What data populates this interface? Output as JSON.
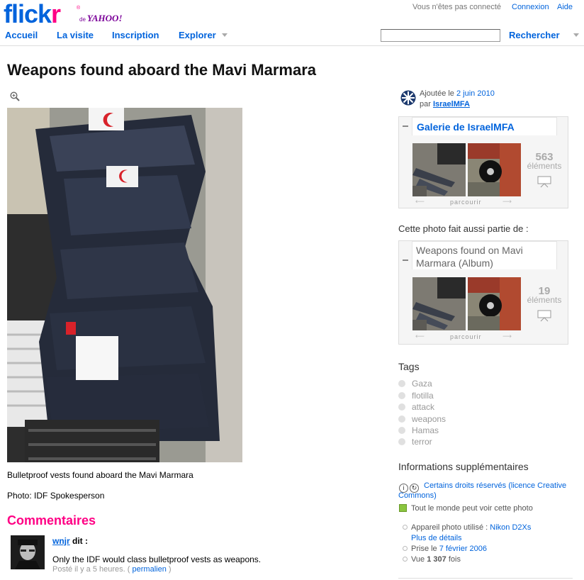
{
  "brand": {
    "logo_part1": "flick",
    "logo_part2": "r",
    "logo_reg": "®",
    "logo_de": "de",
    "logo_yahoo": "YAHOO!"
  },
  "topbar": {
    "status": "Vous n'êtes pas connecté",
    "login": "Connexion",
    "help": "Aide"
  },
  "nav": {
    "home": "Accueil",
    "tour": "La visite",
    "signup": "Inscription",
    "explore": "Explorer"
  },
  "search": {
    "value": "",
    "button": "Rechercher"
  },
  "photo": {
    "title": "Weapons found aboard the Mavi Marmara",
    "caption": "Bulletproof vests found aboard the Mavi Marmara",
    "credit": "Photo: IDF Spokesperson"
  },
  "comments": {
    "heading": "Commentaires",
    "items": [
      {
        "author": "wnjr",
        "says": "dit :",
        "text": "Only the IDF would class bulletproof vests as weapons.",
        "posted": "Posté il y a 5 heures.",
        "permalink": "permalien"
      }
    ]
  },
  "owner": {
    "added_prefix": "Ajoutée le",
    "added_date": "2 juin 2010",
    "by_prefix": "par",
    "name": "IsraelMFA"
  },
  "gallery": {
    "title": "Galerie de IsraelMFA",
    "count": "563",
    "count_label": "éléments",
    "browse": "parcourir"
  },
  "also_in": {
    "heading": "Cette photo fait aussi partie de :",
    "album_title_line1": "Weapons found on Mavi",
    "album_title_line2": "Marmara (Album)",
    "count": "19",
    "count_label": "éléments",
    "browse": "parcourir"
  },
  "tags": {
    "heading": "Tags",
    "items": [
      "Gaza",
      "flotilla",
      "attack",
      "weapons",
      "Hamas",
      "terror"
    ]
  },
  "more_info": {
    "heading": "Informations supplémentaires",
    "license_line1": "Certains droits réservés (licence Creative",
    "license_line2": "Commons)",
    "privacy": "Tout le monde peut voir cette photo",
    "camera_prefix": "Appareil photo utilisé :",
    "camera": "Nikon D2Xs",
    "more_details": "Plus de détails",
    "taken_prefix": "Prise le",
    "taken_date": "7 février 2006",
    "views_prefix": "Vue",
    "views": "1 307",
    "views_suffix": "fois"
  },
  "colors": {
    "link": "#0063dc",
    "accent": "#ff0084"
  }
}
